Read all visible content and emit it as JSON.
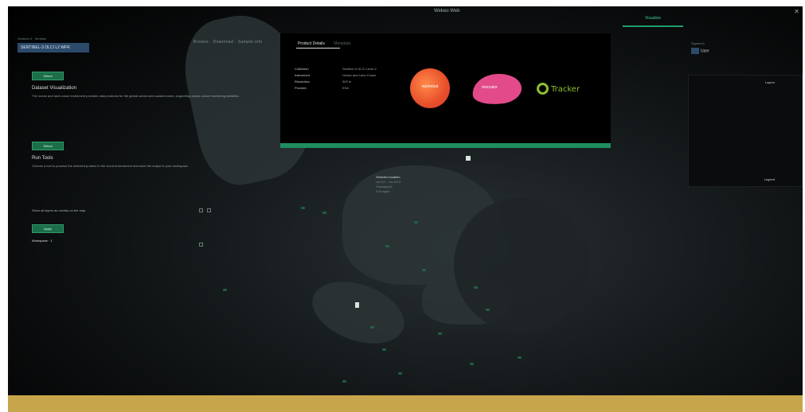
{
  "window": {
    "title": "Wekeo Web",
    "active_tab": "Visualize"
  },
  "left_panel": {
    "small_label": "Sentinel-3 · Sentinel",
    "dataset_badge": "SENTINEL-3 OLCI L2 WFR",
    "top_links": "Browse · Download · Sample info",
    "sections": [
      {
        "button_label": "Select",
        "heading": "Dataset Visualization",
        "description": "The ocean and land colour instrument provides data products for the global ocean and coastal zones, supporting ocean colour monitoring activities."
      },
      {
        "button_label": "Select",
        "heading": "Run Tools",
        "description": "Choose a tool to process the selected product in the cloud environment and save the output to your workspace."
      }
    ],
    "option_text": "Show all layers as overlay on the map",
    "bottom_button_label": "Apply",
    "bottom_text": "Workspace · 1"
  },
  "info_panel": {
    "tabs": [
      "Product Details",
      "Metadata"
    ],
    "progress": 1.0,
    "fields": [
      {
        "key": "Collection",
        "value": "Sentinel-3 OLCI Level-2"
      },
      {
        "key": "Instrument",
        "value": "Ocean and Land Colour"
      },
      {
        "key": "Resolution",
        "value": "300 m"
      },
      {
        "key": "Provider",
        "value": "ESA"
      }
    ],
    "logos": [
      {
        "name": "eumetsat-logo",
        "text": "eumetsat",
        "color": "#e74f2a"
      },
      {
        "name": "mercator-logo",
        "text": "mercator",
        "color": "#e24a8a"
      },
      {
        "name": "ecmwf-logo",
        "text": "Tracker",
        "color": "#8ebf2f"
      }
    ]
  },
  "map_popup": {
    "title": "Selected location",
    "lines": [
      "Lat 24.1 · Lon 121.5",
      "Chlorophyll-a",
      "0.42 mg/m³"
    ]
  },
  "right_panel": {
    "small_label": "Signed in",
    "user_name": "User",
    "top_label": "Layers",
    "bottom_label": "Legend"
  },
  "colors": {
    "accent": "#1f8e5f",
    "bottom_band": "#c7a54a",
    "badge": "#2c4a6a"
  }
}
